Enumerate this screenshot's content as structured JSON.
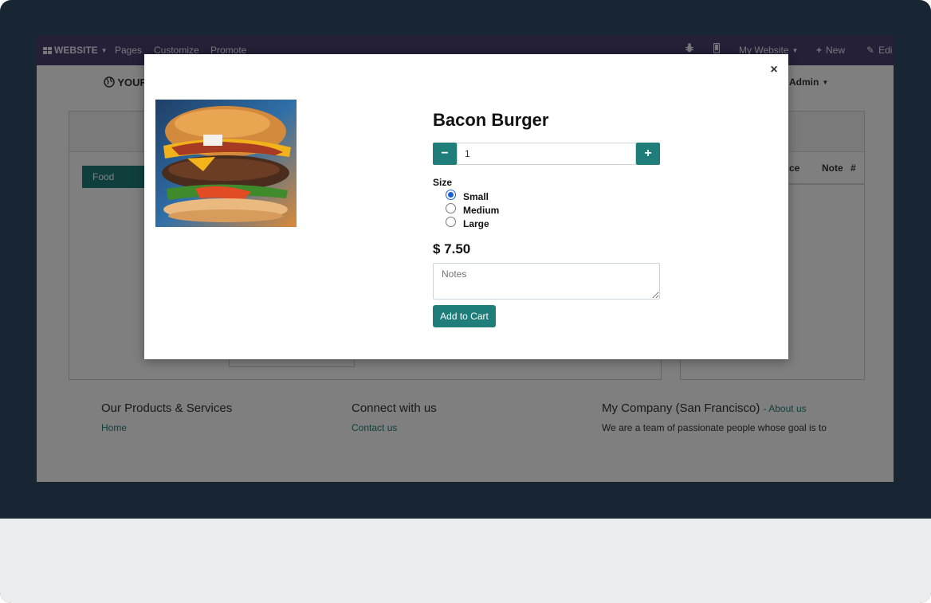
{
  "navbar": {
    "apps_label": "WEBSITE",
    "pages": "Pages",
    "customize": "Customize",
    "promote": "Promote",
    "my_website": "My Website",
    "new": "New",
    "edit": "Edi"
  },
  "site": {
    "logo_text": "YOUR",
    "admin_label": "Admin",
    "category_button": "Food",
    "table_headers": [
      "rice",
      "Note",
      "#"
    ]
  },
  "footer": {
    "col1_title": "Our Products & Services",
    "col1_link": "Home",
    "col2_title": "Connect with us",
    "col2_link": "Contact us",
    "col3_title": "My Company (San Francisco)",
    "col3_about": "- About us",
    "col3_text": "We are a team of passionate people whose goal is to"
  },
  "modal": {
    "close_symbol": "×",
    "product_name": "Bacon Burger",
    "qty_minus": "−",
    "qty_plus": "+",
    "quantity": "1",
    "size_label": "Size",
    "sizes": [
      {
        "label": "Small",
        "selected": true
      },
      {
        "label": "Medium",
        "selected": false
      },
      {
        "label": "Large",
        "selected": false
      }
    ],
    "price": "$ 7.50",
    "notes_placeholder": "Notes",
    "add_to_cart": "Add to Cart"
  },
  "colors": {
    "frame": "#182533",
    "navbar": "#4b3f6e",
    "accent": "#1f7e7a",
    "radio_selected": "#1a5fd6"
  },
  "icons": [
    "apps-grid-icon",
    "bug-icon",
    "mobile-icon",
    "plus-icon",
    "pencil-icon",
    "globe-icon",
    "close-icon",
    "minus-icon"
  ]
}
